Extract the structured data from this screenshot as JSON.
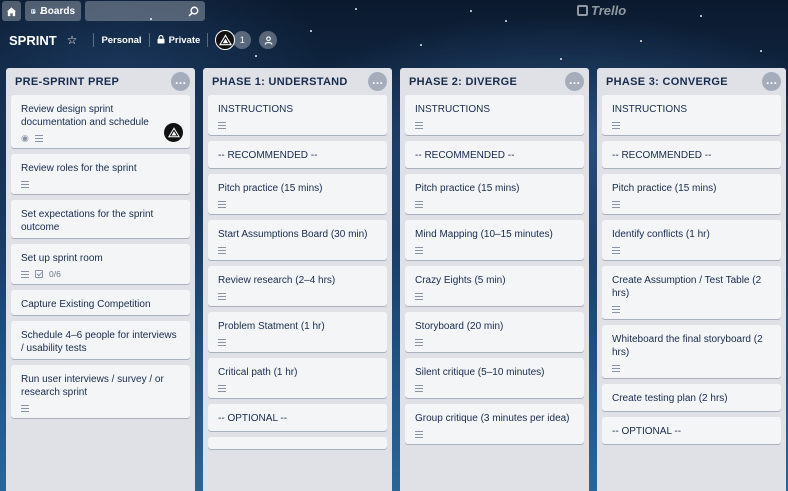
{
  "header": {
    "boards_label": "Boards",
    "logo_text": "Trello"
  },
  "board": {
    "title": "SPRINT",
    "team": "Personal",
    "visibility": "Private",
    "member_count": "1"
  },
  "lists": [
    {
      "title": "PRE-SPRINT PREP",
      "cards": [
        {
          "title": "Review design sprint documentation and schedule",
          "watch": true,
          "desc": true,
          "member": true
        },
        {
          "title": "Review roles for the sprint",
          "desc": true
        },
        {
          "title": "Set expectations for the sprint outcome"
        },
        {
          "title": "Set up sprint room",
          "desc": true,
          "checklist": "0/6"
        },
        {
          "title": "Capture Existing Competition"
        },
        {
          "title": "Schedule 4–6 people for interviews / usability tests"
        },
        {
          "title": "Run user interviews / survey / or research sprint",
          "desc": true
        }
      ]
    },
    {
      "title": "PHASE 1: UNDERSTAND",
      "cards": [
        {
          "title": "INSTRUCTIONS",
          "desc": true
        },
        {
          "title": "-- RECOMMENDED --",
          "section": true
        },
        {
          "title": "Pitch practice (15 mins)",
          "desc": true
        },
        {
          "title": "Start Assumptions Board (30 min)",
          "desc": true
        },
        {
          "title": "Review research (2–4 hrs)",
          "desc": true
        },
        {
          "title": "Problem Statment (1 hr)",
          "desc": true
        },
        {
          "title": "Critical path (1 hr)",
          "desc": true
        },
        {
          "title": "-- OPTIONAL --",
          "section": true
        },
        {
          "title": "",
          "desc": false
        }
      ]
    },
    {
      "title": "PHASE 2: DIVERGE",
      "cards": [
        {
          "title": "INSTRUCTIONS",
          "desc": true
        },
        {
          "title": "-- RECOMMENDED --",
          "section": true
        },
        {
          "title": "Pitch practice (15 mins)",
          "desc": true
        },
        {
          "title": "Mind Mapping (10–15 minutes)",
          "desc": true
        },
        {
          "title": "Crazy Eights (5 min)",
          "desc": true
        },
        {
          "title": "Storyboard (20 min)",
          "desc": true
        },
        {
          "title": "Silent critique (5–10 minutes)",
          "desc": true
        },
        {
          "title": "Group critique (3 minutes per idea)",
          "desc": true
        }
      ]
    },
    {
      "title": "PHASE 3: CONVERGE",
      "cards": [
        {
          "title": "INSTRUCTIONS",
          "desc": true
        },
        {
          "title": "-- RECOMMENDED --",
          "section": true
        },
        {
          "title": "Pitch practice (15 mins)",
          "desc": true
        },
        {
          "title": "Identify conflicts (1 hr)",
          "desc": true
        },
        {
          "title": "Create Assumption / Test Table (2 hrs)",
          "desc": true
        },
        {
          "title": "Whiteboard the final storyboard (2 hrs)",
          "desc": true
        },
        {
          "title": "Create testing plan (2 hrs)",
          "section": true
        },
        {
          "title": "-- OPTIONAL --",
          "section": true
        }
      ]
    }
  ]
}
